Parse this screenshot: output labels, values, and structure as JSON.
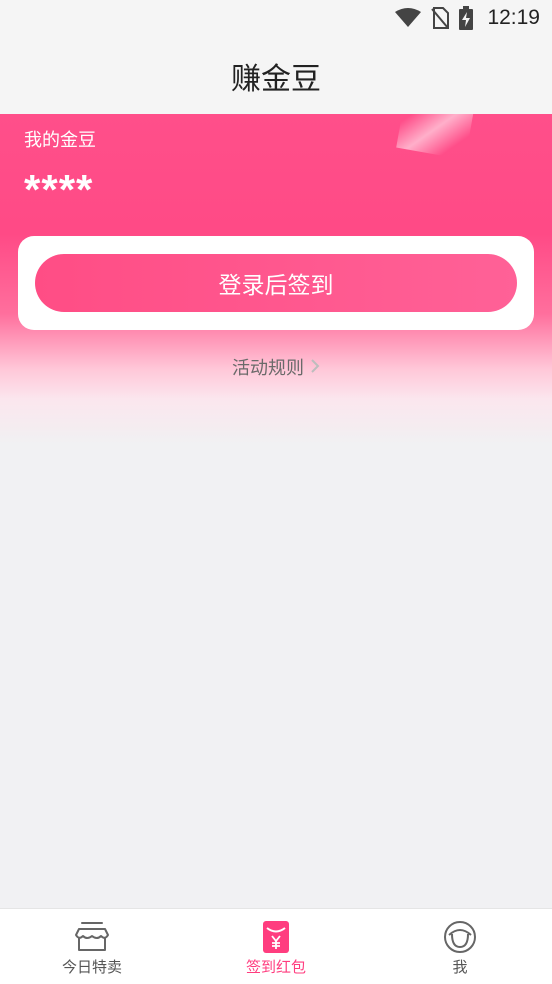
{
  "status_bar": {
    "time": "12:19",
    "icons": [
      "wifi-icon",
      "no-sim-icon",
      "battery-charging-icon"
    ]
  },
  "header": {
    "title": "赚金豆"
  },
  "beans": {
    "label": "我的金豆",
    "value": "****"
  },
  "signin": {
    "button_label": "登录后签到"
  },
  "rules": {
    "link_label": "活动规则",
    "chevron_icon": "chevron-right-icon"
  },
  "tabbar": {
    "tabs": [
      {
        "label": "今日特卖",
        "icon": "store-icon",
        "active": false
      },
      {
        "label": "签到红包",
        "icon": "red-envelope-icon",
        "active": true
      },
      {
        "label": "我",
        "icon": "profile-face-icon",
        "active": false
      }
    ]
  },
  "colors": {
    "accent": "#ff4d85",
    "accent_active_tab": "#ff3d7f",
    "page_bg": "#f1f1f3"
  }
}
